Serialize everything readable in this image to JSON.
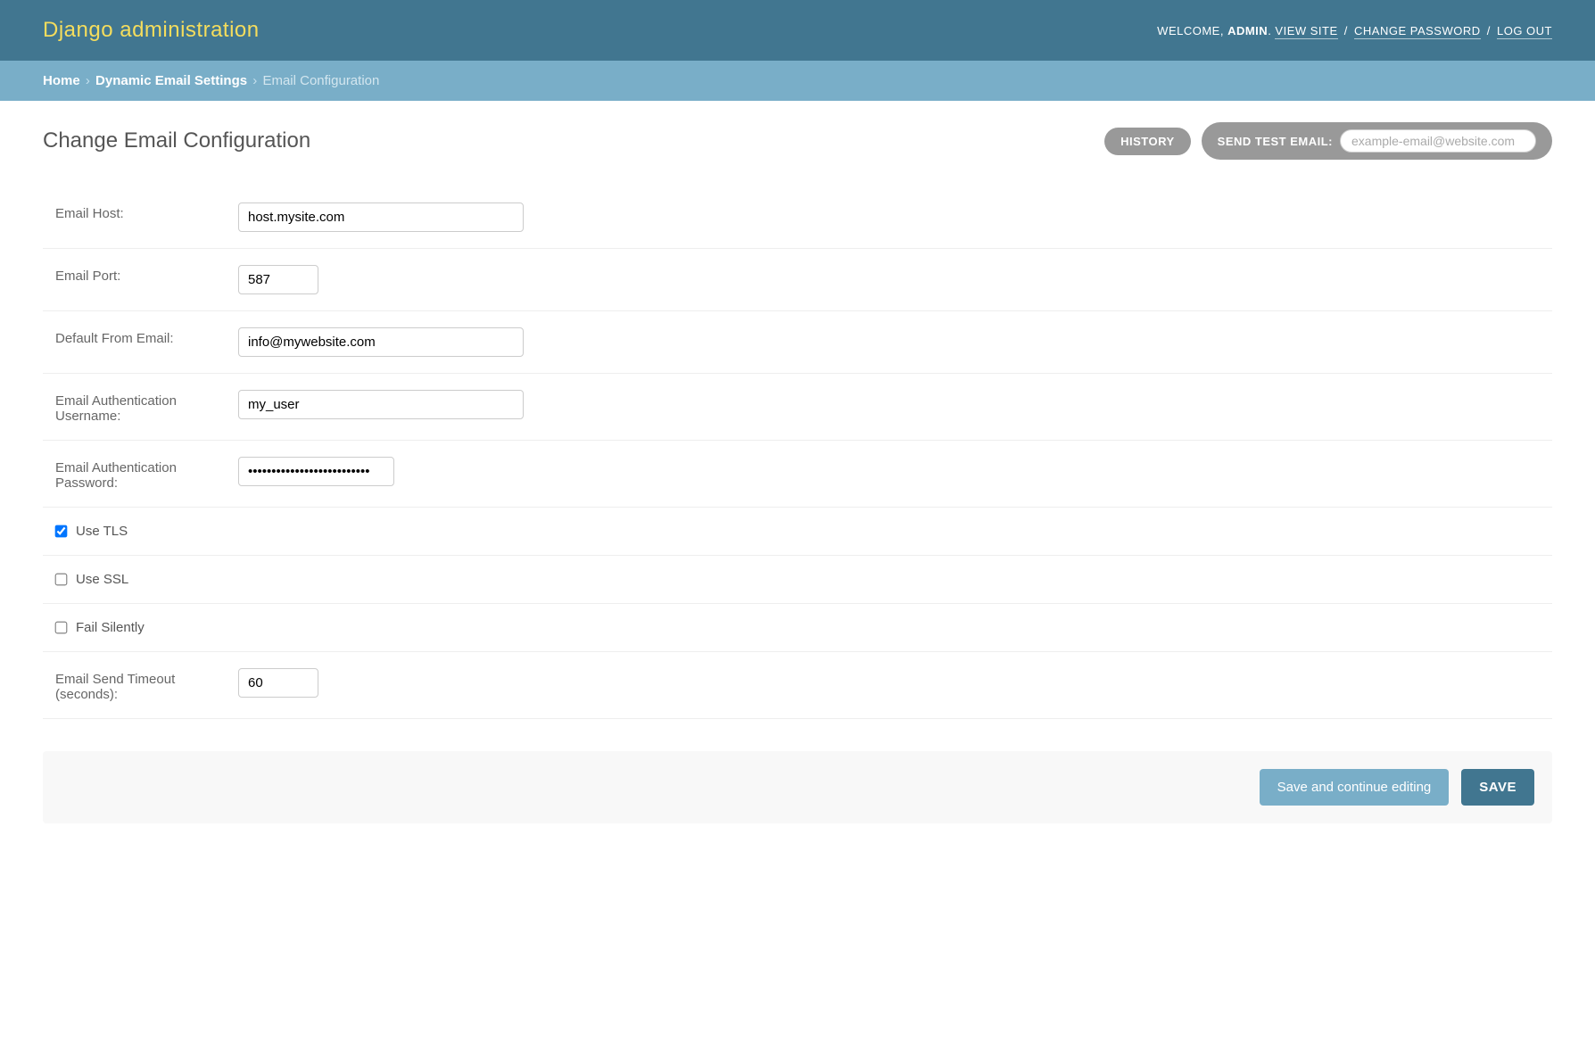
{
  "header": {
    "site_title": "Django administration",
    "welcome_prefix": "WELCOME, ",
    "username": "ADMIN",
    "view_site": "VIEW SITE",
    "change_password": "CHANGE PASSWORD",
    "log_out": "LOG OUT"
  },
  "breadcrumbs": {
    "home": "Home",
    "app": "Dynamic Email Settings",
    "current": "Email Configuration"
  },
  "page": {
    "title": "Change Email Configuration"
  },
  "tools": {
    "history": "HISTORY",
    "send_test_label": "SEND TEST EMAIL:",
    "test_placeholder": "example-email@website.com"
  },
  "form": {
    "email_host_label": "Email Host:",
    "email_host": "host.mysite.com",
    "email_port_label": "Email Port:",
    "email_port": "587",
    "from_email_label": "Default From Email:",
    "from_email": "info@mywebsite.com",
    "auth_user_label": "Email Authentication Username:",
    "auth_user": "my_user",
    "auth_pass_label": "Email Authentication Password:",
    "auth_pass": "••••••••••••••••••••••••••",
    "use_tls_label": "Use TLS",
    "use_tls": true,
    "use_ssl_label": "Use SSL",
    "use_ssl": false,
    "fail_silently_label": "Fail Silently",
    "fail_silently": false,
    "timeout_label": "Email Send Timeout (seconds):",
    "timeout": "60"
  },
  "buttons": {
    "save_continue": "Save and continue editing",
    "save": "SAVE"
  }
}
